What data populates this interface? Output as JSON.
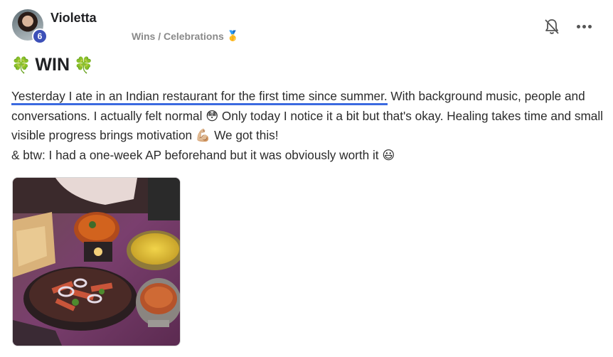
{
  "post": {
    "author": "Violetta",
    "level": "6",
    "category": "Wins / Celebrations",
    "category_icon": "🥇",
    "title": "WIN",
    "title_icon": "🍀",
    "body": {
      "highlighted": "Yesterday I ate in an Indian restaurant for the first time since summer.",
      "p1_rest": " With background music, people and conversations. I actually felt normal ",
      "emoji_flushed": "😳",
      "p1_mid": " Only today I notice it a bit but that's okay. Healing takes time and small visible progress brings motivation ",
      "emoji_muscle": "💪🏼",
      "p1_end": " We got this!",
      "p2": "& btw: I had a one-week AP beforehand but it was obviously worth it ",
      "emoji_smile": "😃"
    },
    "image": {
      "icon": "food-photo"
    }
  },
  "actions": {
    "bell_icon": "bell-icon",
    "more_icon": "more-icon"
  },
  "colors": {
    "accent": "#3b6ae0",
    "badge": "#3d50b8"
  }
}
